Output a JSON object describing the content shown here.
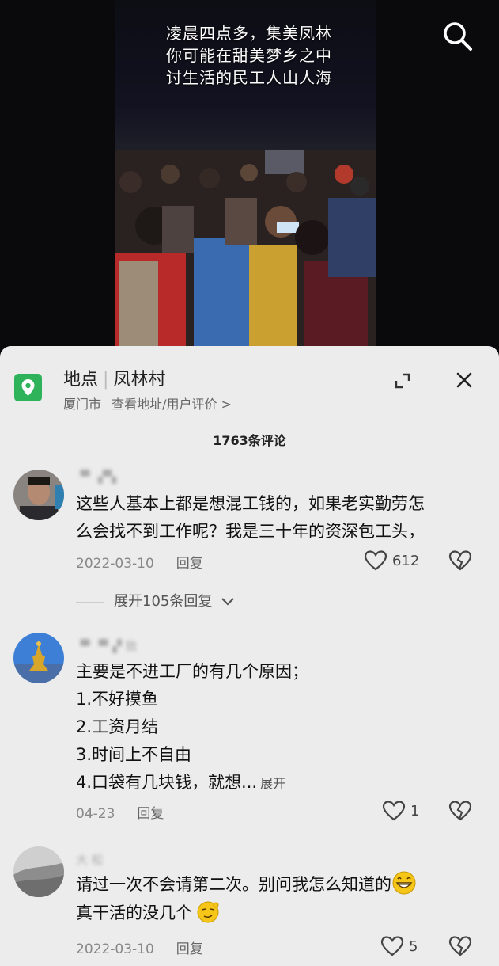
{
  "video": {
    "caption_lines": [
      "凌晨四点多，集美凤林",
      "你可能在甜美梦乡之中",
      "讨生活的民工人山人海"
    ]
  },
  "location": {
    "type_label": "地点",
    "name": "凤林村",
    "city": "厦门市",
    "link_text": "查看地址/用户评价 >"
  },
  "comments_header": {
    "count_text": "1763条评论"
  },
  "comments": [
    {
      "username": "▝▘ ▞▚",
      "lines": [
        "这些人基本上都是想混工钱的，如果老实勤劳怎",
        "么会找不到工作呢？我是三十年的资深包工头，"
      ],
      "date": "2022-03-10",
      "reply_label": "回复",
      "likes": "612",
      "expand_replies": "展开105条回复"
    },
    {
      "username": "▝▘▝▘▞ 致",
      "lines": [
        "主要是不进工厂的有几个原因；",
        "1.不好摸鱼",
        "2.工资月结",
        "3.时间上不自由",
        "4.口袋有几块钱，就想..."
      ],
      "more_label": "展开",
      "date": "04-23",
      "reply_label": "回复",
      "likes": "1"
    },
    {
      "username": "大 松",
      "lines": [
        "请过一次不会请第二次。别问我怎么知道的",
        "真干活的没几个"
      ],
      "date": "2022-03-10",
      "reply_label": "回复",
      "likes": "5"
    }
  ],
  "colors": {
    "location_green": "#2fb35a",
    "sheet_bg": "#ececec"
  }
}
